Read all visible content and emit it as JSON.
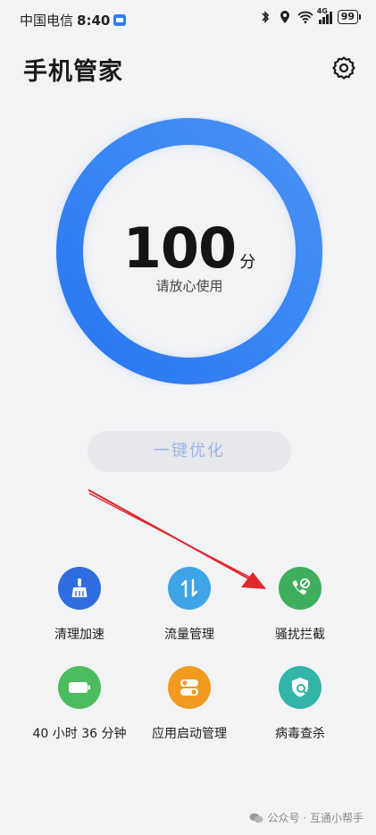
{
  "status_bar": {
    "carrier": "中国电信",
    "time": "8:40",
    "network": "4G",
    "battery": "99"
  },
  "header": {
    "title": "手机管家"
  },
  "score": {
    "value": "100",
    "unit": "分",
    "description": "请放心使用",
    "fraction": 1.0
  },
  "optimize_button": {
    "label": "一键优化"
  },
  "tools": [
    {
      "label": "清理加速",
      "icon": "broom-icon",
      "color": "#2d6de0"
    },
    {
      "label": "流量管理",
      "icon": "data-transfer-icon",
      "color": "#3fa4e6"
    },
    {
      "label": "骚扰拦截",
      "icon": "blocked-call-icon",
      "color": "#3fae5c"
    },
    {
      "label": "40 小时 36 分钟",
      "icon": "battery-icon",
      "color": "#4cbd5e"
    },
    {
      "label": "应用启动管理",
      "icon": "app-launch-toggle-icon",
      "color": "#f29a1f"
    },
    {
      "label": "病毒查杀",
      "icon": "virus-scan-shield-icon",
      "color": "#32b5a8"
    }
  ],
  "watermark": {
    "text": "公众号 · 互通小帮手"
  },
  "colors": {
    "ring_primary": "#2f80f5",
    "annotation_arrow": "#e0282e"
  }
}
